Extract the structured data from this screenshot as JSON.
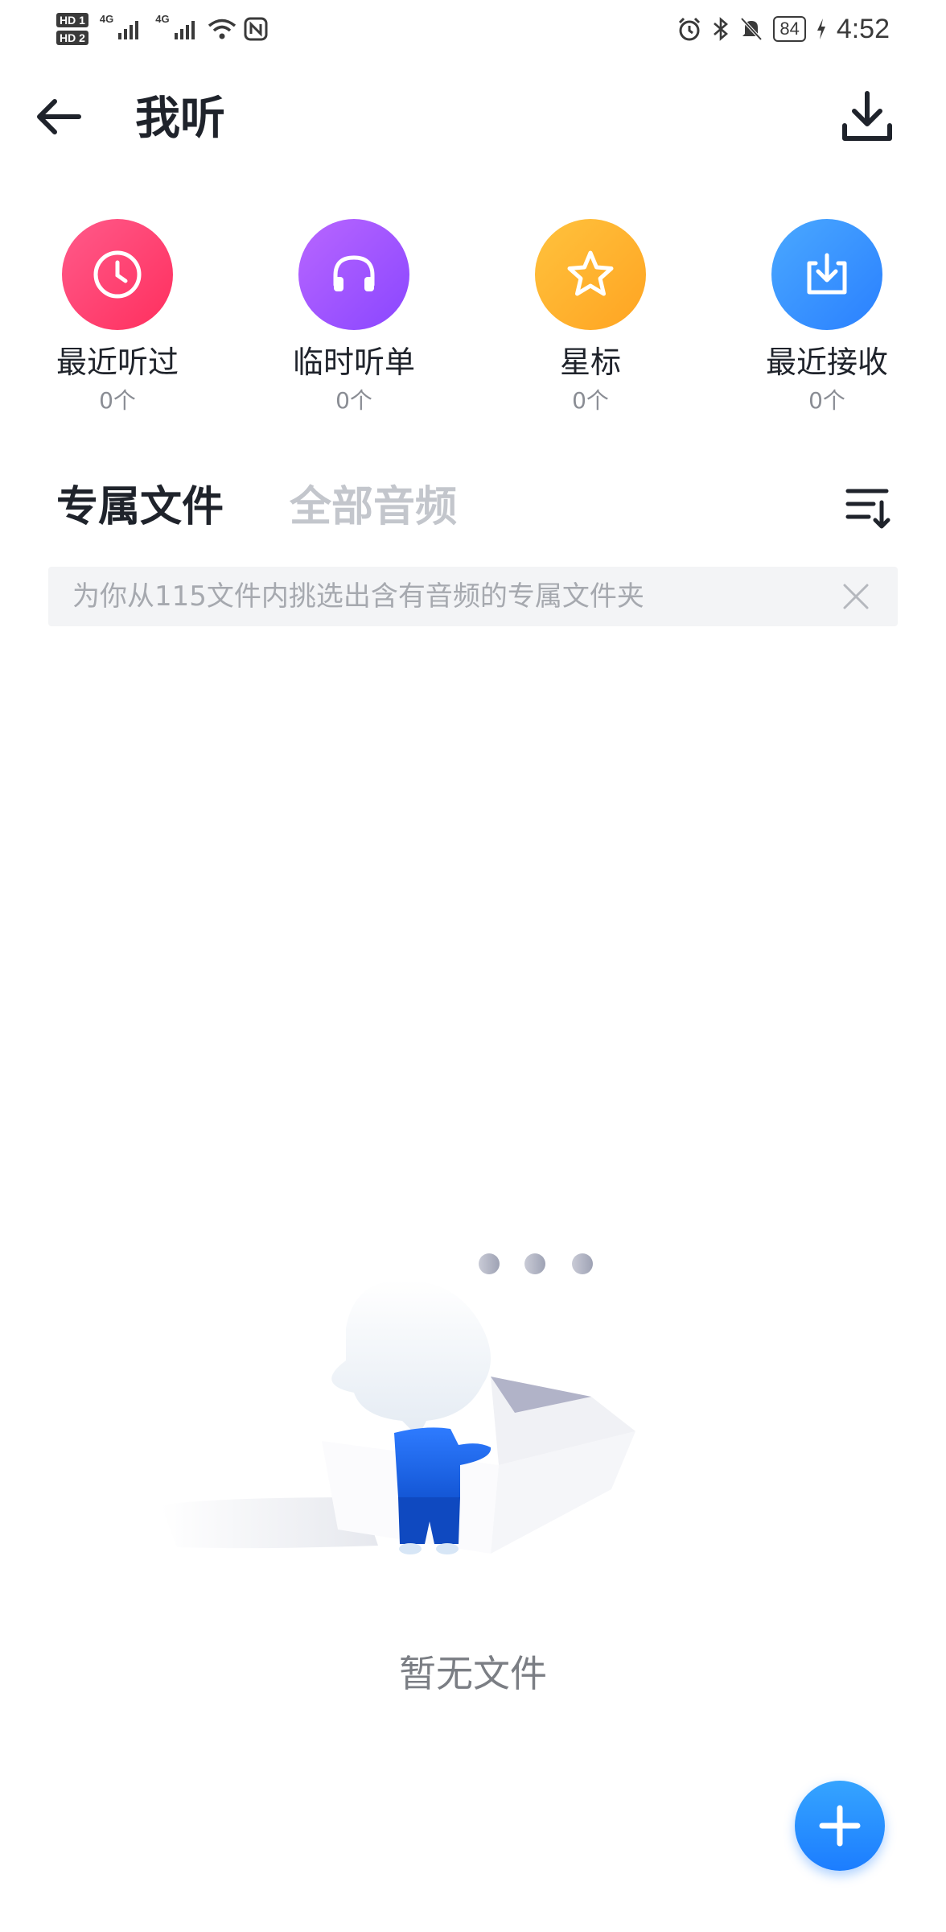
{
  "status_bar": {
    "sim1": "HD 1",
    "sim2": "HD 2",
    "net1": "4G",
    "net2": "4G",
    "battery": "84",
    "time": "4:52",
    "icons": [
      "signal-icon",
      "wifi-icon",
      "nfc-icon",
      "alarm-icon",
      "bluetooth-icon",
      "mute-icon",
      "charging-icon"
    ]
  },
  "header": {
    "title": "我听",
    "back_icon": "arrow-left-icon",
    "download_icon": "download-icon"
  },
  "quick_entries": [
    {
      "label": "最近听过",
      "count": "0个",
      "icon": "clock-icon",
      "color": "#ff3f72"
    },
    {
      "label": "临时听单",
      "count": "0个",
      "icon": "headphones-icon",
      "color": "#9a57ff"
    },
    {
      "label": "星标",
      "count": "0个",
      "icon": "star-icon",
      "color": "#ffb22e"
    },
    {
      "label": "最近接收",
      "count": "0个",
      "icon": "inbox-download-icon",
      "color": "#2f8fff"
    }
  ],
  "tabs": [
    {
      "label": "专属文件",
      "active": true
    },
    {
      "label": "全部音频",
      "active": false
    }
  ],
  "tip": {
    "text": "为你从115文件内挑选出含有音频的专属文件夹"
  },
  "empty": {
    "text": "暂无文件"
  },
  "colors": {
    "accent": "#1c7dff",
    "text_primary": "#1f232b",
    "text_muted": "#c3c6cc"
  }
}
